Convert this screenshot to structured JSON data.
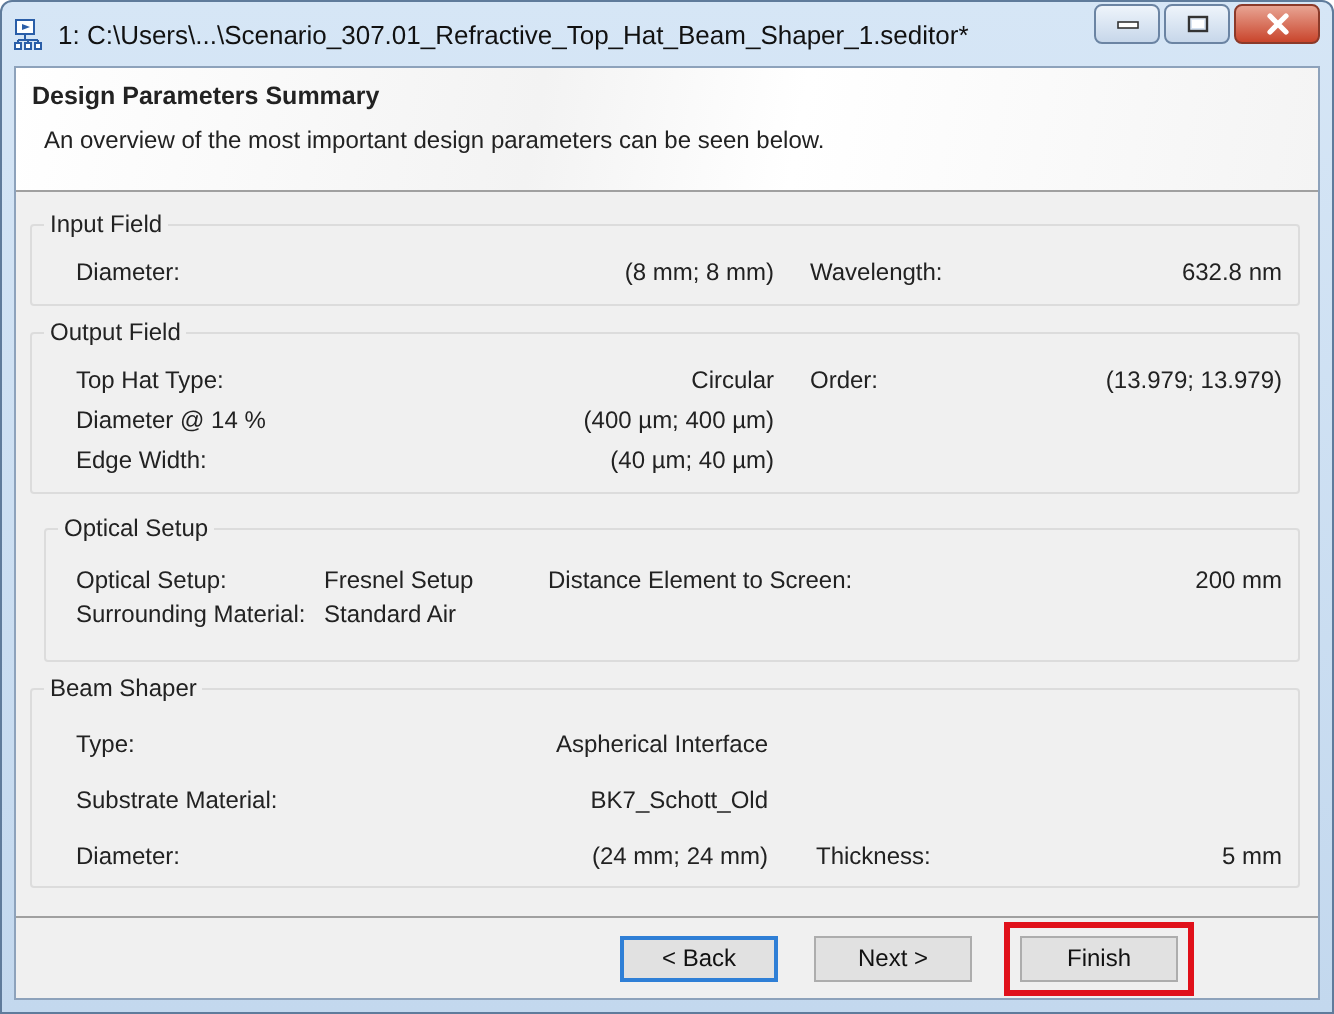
{
  "window": {
    "title": "1: C:\\Users\\...\\Scenario_307.01_Refractive_Top_Hat_Beam_Shaper_1.seditor*"
  },
  "header": {
    "title": "Design Parameters Summary",
    "description": "An overview of the most important design parameters can be seen below."
  },
  "groups": [
    {
      "title": "Input Field",
      "kind": "standard",
      "rows": [
        {
          "label": "Diameter:",
          "value": "(8 mm; 8 mm)",
          "label2": "Wavelength:",
          "value2": "632.8 nm"
        }
      ]
    },
    {
      "title": "Output Field",
      "kind": "standard",
      "rows": [
        {
          "label": "Top Hat Type:",
          "value": "Circular",
          "label2": "Order:",
          "value2": "(13.979; 13.979)"
        },
        {
          "label": "Diameter @ 14 %",
          "value": "(400 µm; 400 µm)"
        },
        {
          "label": "Edge Width:",
          "value": "(40 µm; 40 µm)"
        }
      ]
    },
    {
      "title": "Optical Setup",
      "kind": "inline",
      "rows": [
        {
          "label": "Optical Setup:",
          "value": "Fresnel Setup",
          "label2": "Distance Element to Screen:",
          "value2": "200 mm"
        },
        {
          "label": "Surrounding Material:",
          "value": "Standard Air"
        }
      ]
    },
    {
      "title": "Beam Shaper",
      "kind": "spaced",
      "rows": [
        {
          "label": "Type:",
          "value": "Aspherical Interface"
        },
        {
          "label": "Substrate Material:",
          "value": "BK7_Schott_Old"
        },
        {
          "label": "Diameter:",
          "value": "(24 mm; 24 mm)",
          "label2": "Thickness:",
          "value2": "5 mm"
        }
      ]
    }
  ],
  "buttons": [
    {
      "label": "< Back",
      "default": true,
      "highlighted": false
    },
    {
      "label": "Next >",
      "default": false,
      "highlighted": false
    },
    {
      "label": "Finish",
      "default": false,
      "highlighted": true
    }
  ]
}
